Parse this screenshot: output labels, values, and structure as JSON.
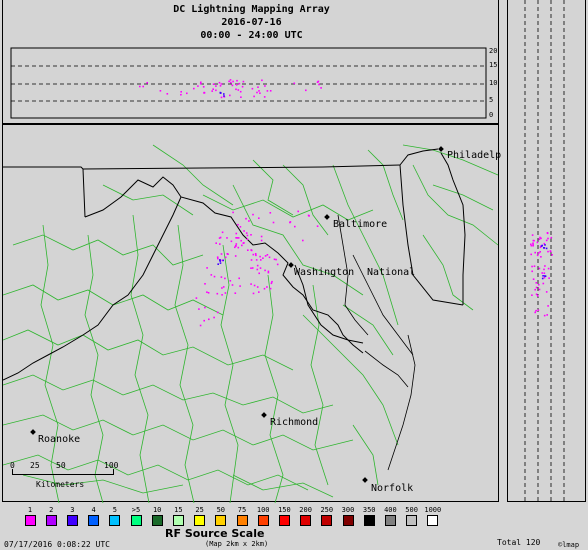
{
  "header": {
    "title": "DC Lightning Mapping Array",
    "date": "2016-07-16",
    "time_range": "00:00 - 24:00 UTC"
  },
  "altitude_axis": {
    "ticks": [
      "20",
      "15",
      "10",
      "5",
      "0"
    ]
  },
  "cities": [
    {
      "name": "Philadelp"
    },
    {
      "name": "Baltimore"
    },
    {
      "name": "Washington"
    },
    {
      "name": "National"
    },
    {
      "name": "Richmond"
    },
    {
      "name": "Roanoke"
    },
    {
      "name": "Norfolk"
    }
  ],
  "scale": {
    "ticks": [
      "0",
      "25",
      "50",
      "100"
    ],
    "unit": "Kilometers"
  },
  "legend": {
    "title": "RF Source Scale",
    "subtitle": "(Map 2km x 2km)",
    "items": [
      {
        "label": "1",
        "color": "#ff00ff"
      },
      {
        "label": "2",
        "color": "#b000ff"
      },
      {
        "label": "3",
        "color": "#4000ff"
      },
      {
        "label": "4",
        "color": "#0060ff"
      },
      {
        "label": "5",
        "color": "#00c0ff"
      },
      {
        "label": ">5",
        "color": "#00ff80"
      },
      {
        "label": "10",
        "color": "#1a6a2a"
      },
      {
        "label": "15",
        "color": "#b0ffb0"
      },
      {
        "label": "25",
        "color": "#ffff00"
      },
      {
        "label": "50",
        "color": "#ffd000"
      },
      {
        "label": "75",
        "color": "#ff8000"
      },
      {
        "label": "100",
        "color": "#ff4000"
      },
      {
        "label": "150",
        "color": "#ff0000"
      },
      {
        "label": "200",
        "color": "#e00000"
      },
      {
        "label": "250",
        "color": "#c00000"
      },
      {
        "label": "300",
        "color": "#800000"
      },
      {
        "label": "350",
        "color": "#000000"
      },
      {
        "label": "400",
        "color": "#808080"
      },
      {
        "label": "500",
        "color": "#c0c0c0"
      },
      {
        "label": "1000",
        "color": "#ffffff"
      }
    ]
  },
  "footer": {
    "timestamp": "07/17/2016  0:08:22 UTC",
    "total": "Total 120",
    "credit": "©lmap"
  }
}
